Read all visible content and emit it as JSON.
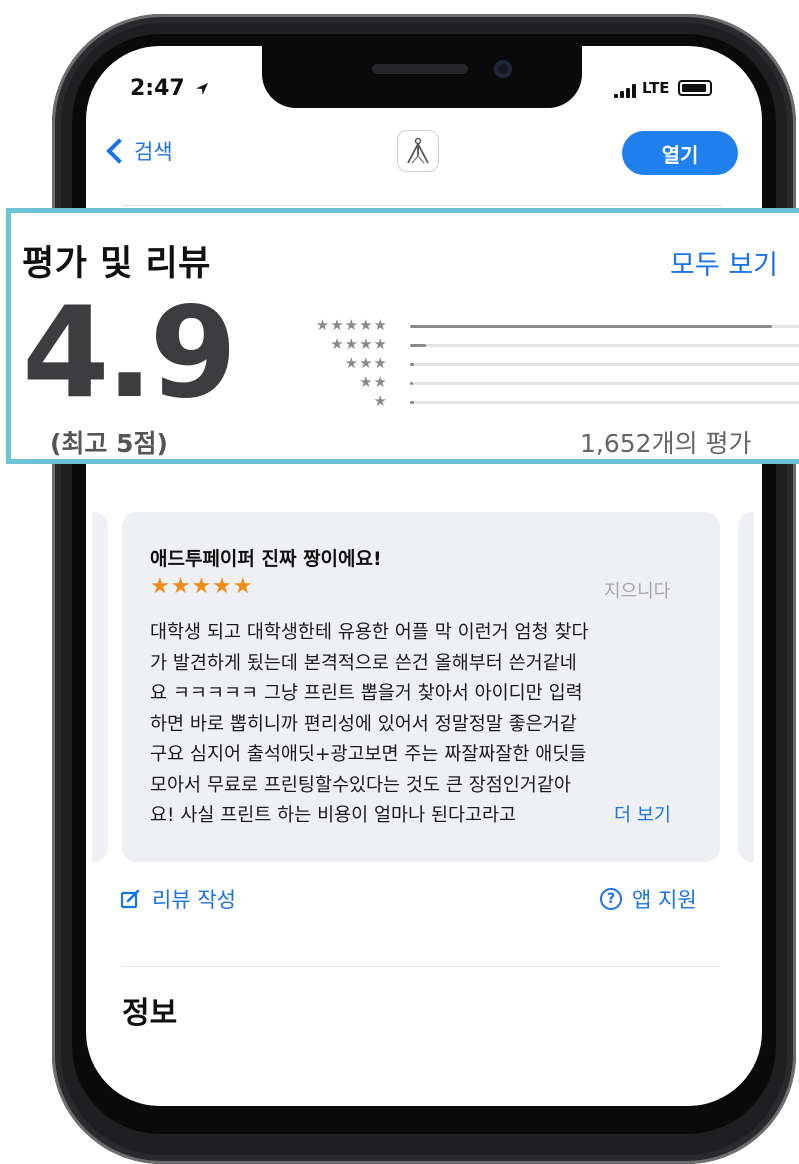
{
  "status_bar": {
    "time": "2:47",
    "network": "LTE"
  },
  "nav": {
    "back_label": "검색",
    "open_button": "열기",
    "app_icon": "tripod-logo-icon"
  },
  "ratings": {
    "title": "평가 및 리뷰",
    "see_all": "모두 보기",
    "score": "4.9",
    "max_label": "(최고 5점)",
    "count_label": "1,652개의 평가",
    "distribution": [
      {
        "stars": "★★★★★",
        "fraction": 0.92
      },
      {
        "stars": "★★★★",
        "fraction": 0.04
      },
      {
        "stars": "★★★",
        "fraction": 0.01
      },
      {
        "stars": "★★",
        "fraction": 0.005
      },
      {
        "stars": "★",
        "fraction": 0.01
      }
    ]
  },
  "review": {
    "title": "애드투페이퍼 진짜 짱이에요!",
    "stars": "★★★★★",
    "author": "지으니다",
    "body_lines": [
      "대학생 되고 대학생한테 유용한 어플 막 이런거 엄청 찾다",
      "가 발견하게 됬는데 본격적으로 쓴건 올해부터 쓴거같네",
      "요 ㅋㅋㅋㅋㅋ 그냥 프린트 뽑을거 찾아서 아이디만 입력",
      "하면 바로 뽑히니까 편리성에 있어서 정말정말 좋은거같",
      "구요 심지어 출석애딧+광고보면 주는 짜잘짜잘한 애딧들",
      "모아서 무료로 프린팅할수있다는 것도 큰 장점인거같아",
      "요! 사실 프린트 하는 비용이 얼마나 된다고라고"
    ],
    "more_label": "더 보기"
  },
  "actions": {
    "write_review": "리뷰 작성",
    "app_support": "앱 지원"
  },
  "info": {
    "title": "정보"
  },
  "colors": {
    "accent": "#1a73e8",
    "open_button": "#1f80ee",
    "star_orange": "#ef8d1b",
    "highlight_border": "#6cc3d5",
    "card_bg": "#eff0f4"
  }
}
